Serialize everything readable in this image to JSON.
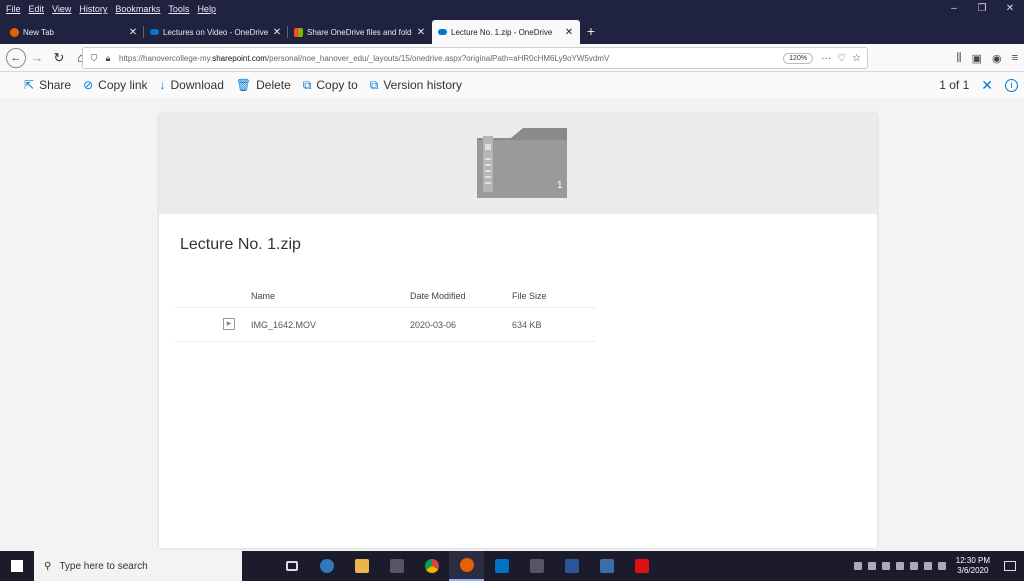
{
  "browser": {
    "menu": [
      "File",
      "Edit",
      "View",
      "History",
      "Bookmarks",
      "Tools",
      "Help"
    ],
    "tabs": [
      {
        "title": "New Tab",
        "favicon_color": "#e66000",
        "active": false
      },
      {
        "title": "Lectures on Video - OneDrive",
        "favicon_color": "#0078d4",
        "active": false
      },
      {
        "title": "Share OneDrive files and folder",
        "favicon_color": "#f25022",
        "active": false
      },
      {
        "title": "Lecture No. 1.zip - OneDrive",
        "favicon_color": "#0078d4",
        "active": true
      }
    ],
    "url_prefix": "https://hanovercollege-my.",
    "url_domain": "sharepoint.com",
    "url_suffix": "/personal/noe_hanover_edu/_layouts/15/onedrive.aspx?originalPath=aHR0cHM6Ly9oYW5vdmV",
    "zoom": "120%"
  },
  "commands": {
    "share": "Share",
    "copy_link": "Copy link",
    "download": "Download",
    "delete": "Delete",
    "copy_to": "Copy to",
    "version_history": "Version history",
    "pager": "1 of 1"
  },
  "file": {
    "title": "Lecture No. 1.zip",
    "zip_count": "1",
    "columns": {
      "name": "Name",
      "date": "Date Modified",
      "size": "File Size"
    },
    "rows": [
      {
        "name": "IMG_1642.MOV",
        "date": "2020-03-06",
        "size": "634 KB"
      }
    ]
  },
  "taskbar": {
    "search_placeholder": "Type here to search",
    "time": "12:30 PM",
    "date": "3/6/2020"
  },
  "colors": {
    "accent": "#0078d4",
    "titlebar": "#202340",
    "taskbar": "#1b1b2b"
  }
}
